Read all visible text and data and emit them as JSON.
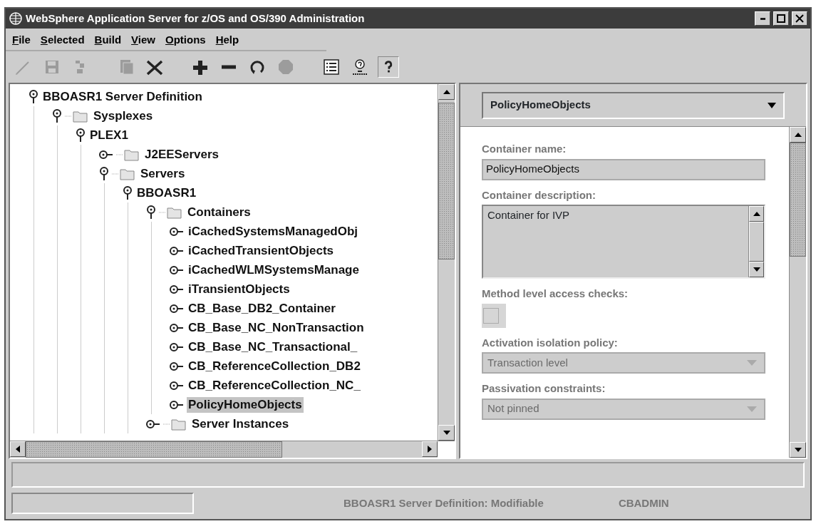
{
  "window": {
    "title": "WebSphere Application Server for z/OS and OS/390 Administration"
  },
  "menu": [
    "File",
    "Selected",
    "Build",
    "View",
    "Options",
    "Help"
  ],
  "toolbar": [
    {
      "kind": "edit",
      "disabled": true
    },
    {
      "kind": "save",
      "disabled": true
    },
    {
      "kind": "revert",
      "disabled": true
    },
    {
      "kind": "copy",
      "disabled": true
    },
    {
      "kind": "delete",
      "disabled": false
    },
    {
      "kind": "add",
      "disabled": false
    },
    {
      "kind": "remove",
      "disabled": false
    },
    {
      "kind": "refresh",
      "disabled": false
    },
    {
      "kind": "stop",
      "disabled": true
    },
    {
      "kind": "list",
      "disabled": false
    },
    {
      "kind": "helpuser",
      "disabled": false
    },
    {
      "kind": "help",
      "disabled": false
    }
  ],
  "tree": [
    {
      "label": "BBOASR1 Server Definition",
      "kind": "node",
      "expanded": true,
      "selected": false,
      "children": [
        {
          "label": "Sysplexes",
          "kind": "folder",
          "expanded": true,
          "selected": false,
          "children": [
            {
              "label": "PLEX1",
              "kind": "node",
              "expanded": true,
              "selected": false,
              "children": [
                {
                  "label": "J2EEServers",
                  "kind": "folder",
                  "expanded": false,
                  "selected": false
                },
                {
                  "label": "Servers",
                  "kind": "folder",
                  "expanded": true,
                  "selected": false,
                  "children": [
                    {
                      "label": "BBOASR1",
                      "kind": "node",
                      "expanded": true,
                      "selected": false,
                      "children": [
                        {
                          "label": "Containers",
                          "kind": "folder",
                          "expanded": true,
                          "selected": false,
                          "children": [
                            {
                              "label": "iCachedSystemsManagedObj",
                              "kind": "node",
                              "expanded": false,
                              "selected": false
                            },
                            {
                              "label": "iCachedTransientObjects",
                              "kind": "node",
                              "expanded": false,
                              "selected": false
                            },
                            {
                              "label": "iCachedWLMSystemsManage",
                              "kind": "node",
                              "expanded": false,
                              "selected": false
                            },
                            {
                              "label": "iTransientObjects",
                              "kind": "node",
                              "expanded": false,
                              "selected": false
                            },
                            {
                              "label": "CB_Base_DB2_Container",
                              "kind": "node",
                              "expanded": false,
                              "selected": false
                            },
                            {
                              "label": "CB_Base_NC_NonTransaction",
                              "kind": "node",
                              "expanded": false,
                              "selected": false
                            },
                            {
                              "label": "CB_Base_NC_Transactional_",
                              "kind": "node",
                              "expanded": false,
                              "selected": false
                            },
                            {
                              "label": "CB_ReferenceCollection_DB2",
                              "kind": "node",
                              "expanded": false,
                              "selected": false
                            },
                            {
                              "label": "CB_ReferenceCollection_NC_",
                              "kind": "node",
                              "expanded": false,
                              "selected": false
                            },
                            {
                              "label": "PolicyHomeObjects",
                              "kind": "node",
                              "expanded": false,
                              "selected": true
                            }
                          ]
                        },
                        {
                          "label": "Server Instances",
                          "kind": "folder",
                          "expanded": false,
                          "selected": false
                        }
                      ]
                    }
                  ]
                }
              ]
            }
          ]
        }
      ]
    }
  ],
  "detail": {
    "selector": "PolicyHomeObjects",
    "fields": [
      {
        "kind": "text",
        "label": "Container name:",
        "value": "PolicyHomeObjects"
      },
      {
        "kind": "textarea",
        "label": "Container description:",
        "value": "Container for IVP"
      },
      {
        "kind": "checkbox",
        "label": "Method level access checks:",
        "checked": false,
        "disabled": true
      },
      {
        "kind": "select",
        "label": "Activation isolation policy:",
        "value": "Transaction level",
        "disabled": true
      },
      {
        "kind": "select",
        "label": "Passivation constraints:",
        "value": "Not pinned",
        "disabled": true
      }
    ]
  },
  "status_bar": {
    "message": "BBOASR1 Server Definition: Modifiable",
    "user": "CBADMIN"
  }
}
